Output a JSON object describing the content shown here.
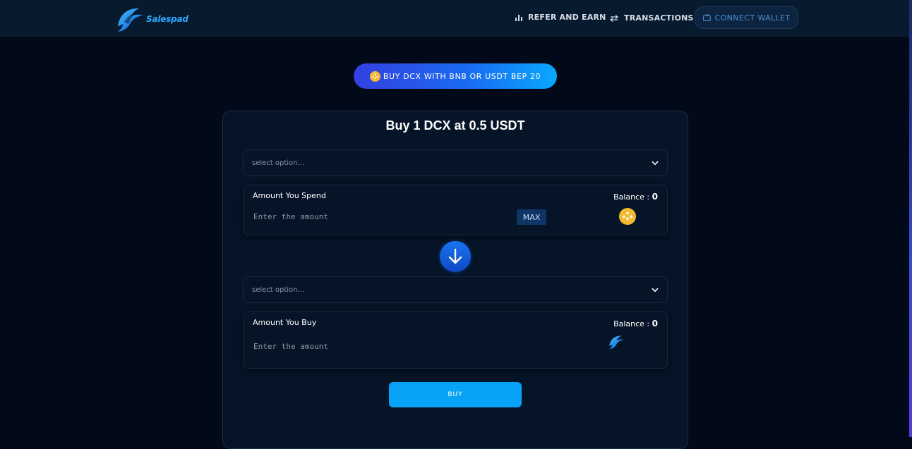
{
  "header": {
    "logo_text": "Salespad",
    "nav": {
      "refer_label": "REFER AND EARN",
      "transactions_label": "TRANSACTIONS"
    },
    "connect_wallet_label": "CONNECT WALLET"
  },
  "banner": {
    "label": "BUY DCX WITH BNB OR USDT BEP 20"
  },
  "card": {
    "title": "Buy 1 DCX at 0.5 USDT",
    "from_select": {
      "placeholder": "select option..."
    },
    "spend": {
      "label": "Amount You Spend",
      "balance_label": "Balance : ",
      "balance_value": "0",
      "placeholder": "Enter the amount",
      "max_label": "MAX",
      "token_icon": "bnb-icon"
    },
    "to_select": {
      "placeholder": "select option..."
    },
    "receive": {
      "label": "Amount You Buy",
      "balance_label": "Balance : ",
      "balance_value": "0",
      "placeholder": "Enter the amount",
      "token_icon": "dcx-icon"
    },
    "buy_label": "BUY"
  },
  "colors": {
    "background": "#020a1a",
    "header": "#071a2e",
    "accent": "#08a2f6",
    "bnb": "#f3ba2f"
  }
}
